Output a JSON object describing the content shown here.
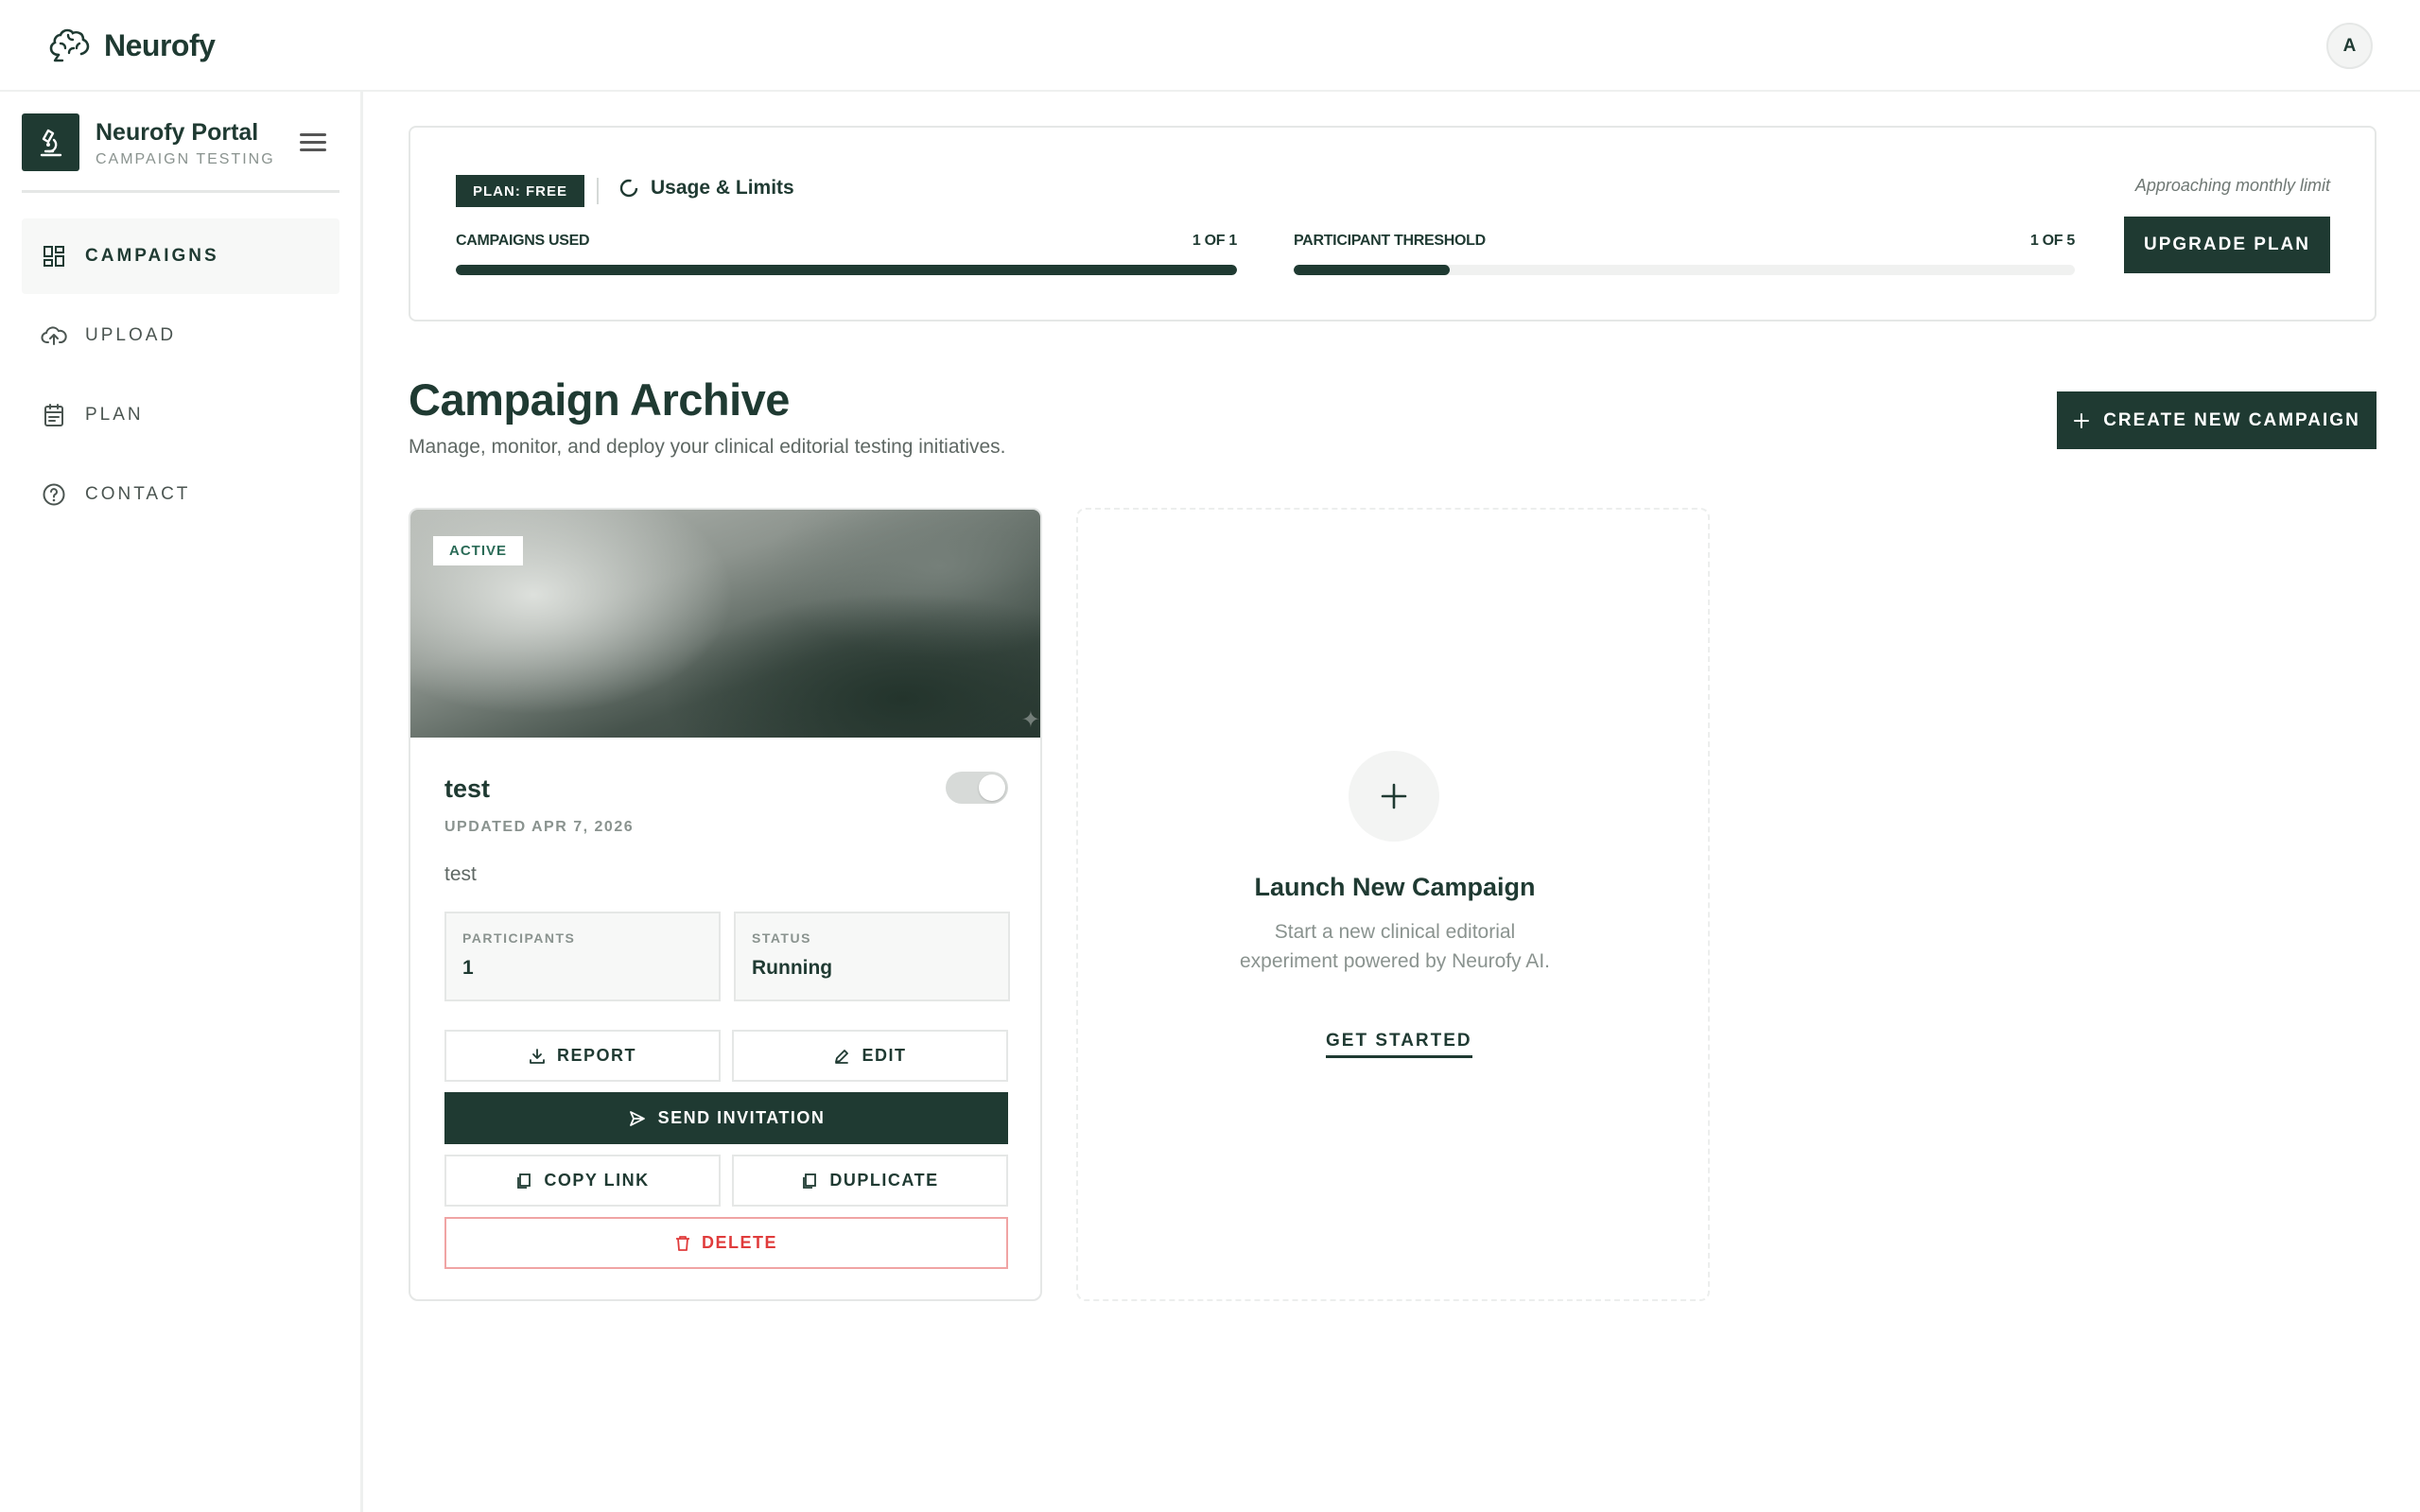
{
  "app": {
    "brand_name": "Neurofy",
    "avatar_initial": "A"
  },
  "sidebar": {
    "portal_title": "Neurofy Portal",
    "portal_subtitle": "CAMPAIGN TESTING",
    "items": [
      {
        "label": "CAMPAIGNS",
        "icon": "dashboard-icon",
        "active": true
      },
      {
        "label": "UPLOAD",
        "icon": "cloud-upload-icon",
        "active": false
      },
      {
        "label": "PLAN",
        "icon": "calendar-icon",
        "active": false
      },
      {
        "label": "CONTACT",
        "icon": "help-circle-icon",
        "active": false
      }
    ]
  },
  "usage": {
    "plan_badge": "PLAN: FREE",
    "title": "Usage & Limits",
    "limit_note": "Approaching monthly limit",
    "upgrade_label": "UPGRADE PLAN",
    "meters": [
      {
        "label": "CAMPAIGNS USED",
        "value_text": "1 OF 1",
        "used": 1,
        "limit": 1
      },
      {
        "label": "PARTICIPANT THRESHOLD",
        "value_text": "1 OF 5",
        "used": 1,
        "limit": 5
      }
    ]
  },
  "main": {
    "title": "Campaign Archive",
    "subtitle": "Manage, monitor, and deploy your clinical editorial testing initiatives.",
    "create_label": "CREATE NEW CAMPAIGN"
  },
  "campaign": {
    "badge": "ACTIVE",
    "name": "test",
    "updated": "UPDATED APR 7, 2026",
    "description": "test",
    "enabled": true,
    "participants_label": "PARTICIPANTS",
    "participants_value": "1",
    "status_label": "STATUS",
    "status_value": "Running",
    "actions": {
      "report": "REPORT",
      "edit": "EDIT",
      "send_invitation": "SEND INVITATION",
      "copy_link": "COPY LINK",
      "duplicate": "DUPLICATE",
      "delete": "DELETE"
    }
  },
  "launch": {
    "title": "Launch New Campaign",
    "description": "Start a new clinical editorial experiment powered by Neurofy AI.",
    "cta": "GET STARTED"
  },
  "colors": {
    "primary": "#1f3a32",
    "danger": "#e03c3c",
    "badge_text": "#2b6b57"
  }
}
